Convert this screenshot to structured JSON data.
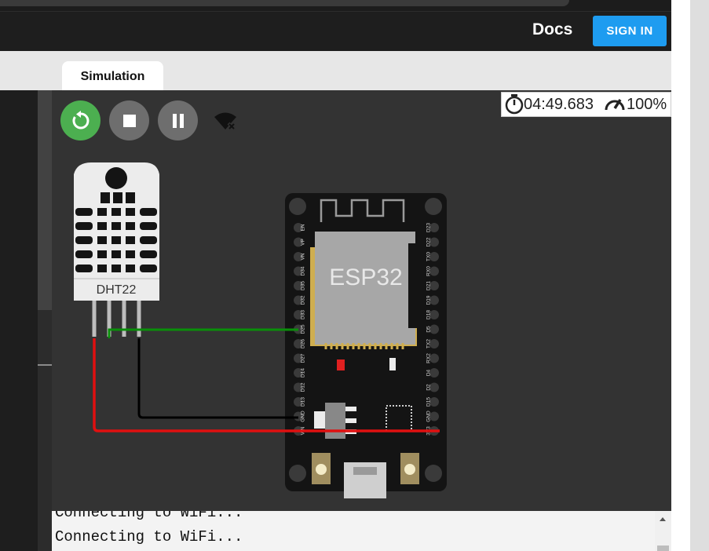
{
  "navbar": {
    "docs_label": "Docs",
    "signin_label": "SIGN IN"
  },
  "tabs": {
    "simulation_label": "Simulation"
  },
  "simulation": {
    "timer": "04:49.683",
    "speed": "100%",
    "controls": [
      "restart-icon",
      "stop-icon",
      "pause-icon",
      "wifi-off-icon"
    ]
  },
  "components": {
    "sensor_label": "DHT22",
    "board_label": "ESP32",
    "left_pins": [
      "EN",
      "VP",
      "VN",
      "D34",
      "D35",
      "D32",
      "D33",
      "D25",
      "D26",
      "D27",
      "D14",
      "D12",
      "D13",
      "GND",
      "VIN"
    ],
    "right_pins": [
      "D23",
      "D22",
      "TX0",
      "RX0",
      "D21",
      "D19",
      "D18",
      "D5",
      "TX2",
      "RX2",
      "D4",
      "D2",
      "D15",
      "GND",
      "3V3"
    ]
  },
  "wires": {
    "data": "#0a8f0a",
    "ground": "#000000",
    "power": "#e01010"
  },
  "console": {
    "lines": [
      "Connecting to WiFi...",
      "Connecting to WiFi..."
    ]
  }
}
